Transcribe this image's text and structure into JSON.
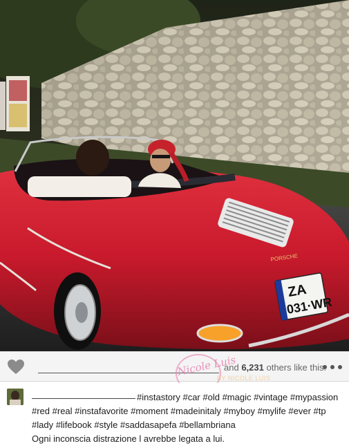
{
  "photo": {
    "icon": "photo-post",
    "license_plate_line1": "ZA",
    "license_plate_line2": "031·WR",
    "car_badge": "PORSCHE"
  },
  "actions": {
    "like_icon": "heart-icon",
    "likes_suffix": "and 6,231 others like this.",
    "likes_count": "6,231",
    "more_icon": "more-dots-icon"
  },
  "watermark": {
    "name": "Nicole Luis",
    "sub": "BY NICOLE LUIS"
  },
  "caption": {
    "hashtags": "#instastory #car #old #magic #vintage #mypassion #red #real #instafavorite #moment #madeinitaly #myboy #mylife #ever #tp #lady #lifebook #style #saddasapefa #bellambriana",
    "text": "Ogni inconscia distrazione l avrebbe legata a lui."
  },
  "colors": {
    "car_red": "#c8192b",
    "stone_wall": "#b9b2a0",
    "action_bar": "#f4f4f4"
  }
}
